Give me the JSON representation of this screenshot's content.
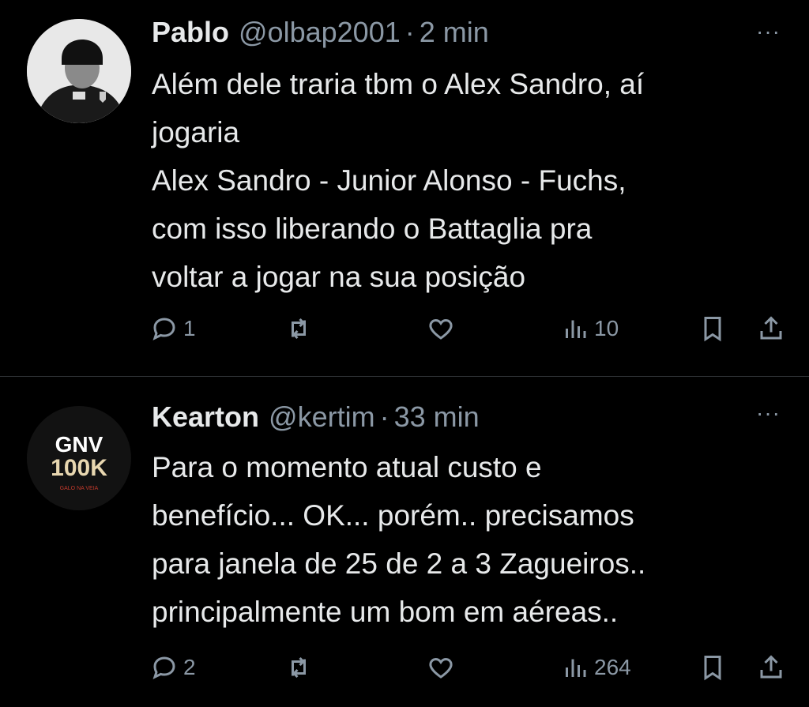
{
  "tweets": [
    {
      "name": "Pablo",
      "handle": "@olbap2001",
      "separator": "·",
      "time": "2 min",
      "more": "···",
      "lines": [
        "Além dele traria tbm o Alex Sandro, aí",
        "jogaria",
        "Alex Sandro - Junior Alonso - Fuchs,",
        "com isso liberando o Battaglia pra",
        "voltar a jogar na sua posição"
      ],
      "replies": "1",
      "views": "10"
    },
    {
      "name": "Kearton",
      "handle": "@kertim",
      "separator": "·",
      "time": "33 min",
      "more": "···",
      "avatar_text": {
        "top": "GNV",
        "bottom": "100K",
        "tag": "GALO NA VEIA"
      },
      "lines": [
        "Para o momento atual custo e",
        "benefício... OK... porém.. precisamos",
        "para janela de 25 de 2 a 3 Zagueiros..",
        "principalmente um bom em aéreas.."
      ],
      "replies": "2",
      "views": "264"
    }
  ]
}
